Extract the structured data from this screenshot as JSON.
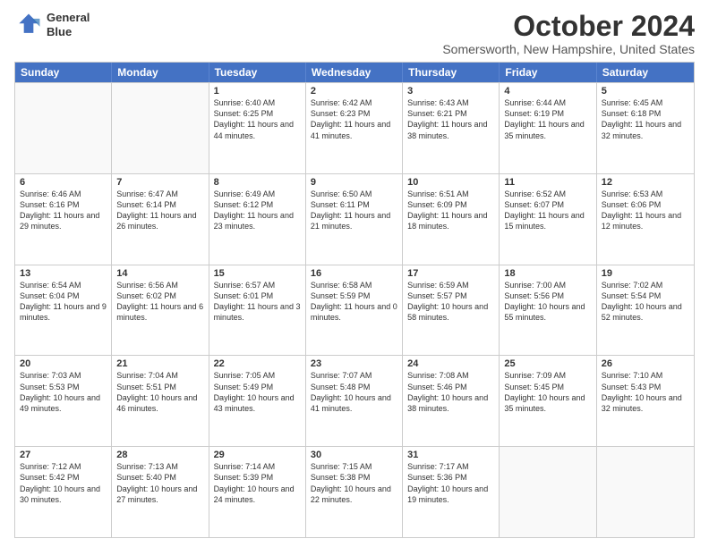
{
  "header": {
    "logo_line1": "General",
    "logo_line2": "Blue",
    "title": "October 2024",
    "subtitle": "Somersworth, New Hampshire, United States"
  },
  "days_of_week": [
    "Sunday",
    "Monday",
    "Tuesday",
    "Wednesday",
    "Thursday",
    "Friday",
    "Saturday"
  ],
  "weeks": [
    [
      {
        "day": "",
        "sunrise": "",
        "sunset": "",
        "daylight": "",
        "empty": true
      },
      {
        "day": "",
        "sunrise": "",
        "sunset": "",
        "daylight": "",
        "empty": true
      },
      {
        "day": "1",
        "sunrise": "Sunrise: 6:40 AM",
        "sunset": "Sunset: 6:25 PM",
        "daylight": "Daylight: 11 hours and 44 minutes."
      },
      {
        "day": "2",
        "sunrise": "Sunrise: 6:42 AM",
        "sunset": "Sunset: 6:23 PM",
        "daylight": "Daylight: 11 hours and 41 minutes."
      },
      {
        "day": "3",
        "sunrise": "Sunrise: 6:43 AM",
        "sunset": "Sunset: 6:21 PM",
        "daylight": "Daylight: 11 hours and 38 minutes."
      },
      {
        "day": "4",
        "sunrise": "Sunrise: 6:44 AM",
        "sunset": "Sunset: 6:19 PM",
        "daylight": "Daylight: 11 hours and 35 minutes."
      },
      {
        "day": "5",
        "sunrise": "Sunrise: 6:45 AM",
        "sunset": "Sunset: 6:18 PM",
        "daylight": "Daylight: 11 hours and 32 minutes."
      }
    ],
    [
      {
        "day": "6",
        "sunrise": "Sunrise: 6:46 AM",
        "sunset": "Sunset: 6:16 PM",
        "daylight": "Daylight: 11 hours and 29 minutes."
      },
      {
        "day": "7",
        "sunrise": "Sunrise: 6:47 AM",
        "sunset": "Sunset: 6:14 PM",
        "daylight": "Daylight: 11 hours and 26 minutes."
      },
      {
        "day": "8",
        "sunrise": "Sunrise: 6:49 AM",
        "sunset": "Sunset: 6:12 PM",
        "daylight": "Daylight: 11 hours and 23 minutes."
      },
      {
        "day": "9",
        "sunrise": "Sunrise: 6:50 AM",
        "sunset": "Sunset: 6:11 PM",
        "daylight": "Daylight: 11 hours and 21 minutes."
      },
      {
        "day": "10",
        "sunrise": "Sunrise: 6:51 AM",
        "sunset": "Sunset: 6:09 PM",
        "daylight": "Daylight: 11 hours and 18 minutes."
      },
      {
        "day": "11",
        "sunrise": "Sunrise: 6:52 AM",
        "sunset": "Sunset: 6:07 PM",
        "daylight": "Daylight: 11 hours and 15 minutes."
      },
      {
        "day": "12",
        "sunrise": "Sunrise: 6:53 AM",
        "sunset": "Sunset: 6:06 PM",
        "daylight": "Daylight: 11 hours and 12 minutes."
      }
    ],
    [
      {
        "day": "13",
        "sunrise": "Sunrise: 6:54 AM",
        "sunset": "Sunset: 6:04 PM",
        "daylight": "Daylight: 11 hours and 9 minutes."
      },
      {
        "day": "14",
        "sunrise": "Sunrise: 6:56 AM",
        "sunset": "Sunset: 6:02 PM",
        "daylight": "Daylight: 11 hours and 6 minutes."
      },
      {
        "day": "15",
        "sunrise": "Sunrise: 6:57 AM",
        "sunset": "Sunset: 6:01 PM",
        "daylight": "Daylight: 11 hours and 3 minutes."
      },
      {
        "day": "16",
        "sunrise": "Sunrise: 6:58 AM",
        "sunset": "Sunset: 5:59 PM",
        "daylight": "Daylight: 11 hours and 0 minutes."
      },
      {
        "day": "17",
        "sunrise": "Sunrise: 6:59 AM",
        "sunset": "Sunset: 5:57 PM",
        "daylight": "Daylight: 10 hours and 58 minutes."
      },
      {
        "day": "18",
        "sunrise": "Sunrise: 7:00 AM",
        "sunset": "Sunset: 5:56 PM",
        "daylight": "Daylight: 10 hours and 55 minutes."
      },
      {
        "day": "19",
        "sunrise": "Sunrise: 7:02 AM",
        "sunset": "Sunset: 5:54 PM",
        "daylight": "Daylight: 10 hours and 52 minutes."
      }
    ],
    [
      {
        "day": "20",
        "sunrise": "Sunrise: 7:03 AM",
        "sunset": "Sunset: 5:53 PM",
        "daylight": "Daylight: 10 hours and 49 minutes."
      },
      {
        "day": "21",
        "sunrise": "Sunrise: 7:04 AM",
        "sunset": "Sunset: 5:51 PM",
        "daylight": "Daylight: 10 hours and 46 minutes."
      },
      {
        "day": "22",
        "sunrise": "Sunrise: 7:05 AM",
        "sunset": "Sunset: 5:49 PM",
        "daylight": "Daylight: 10 hours and 43 minutes."
      },
      {
        "day": "23",
        "sunrise": "Sunrise: 7:07 AM",
        "sunset": "Sunset: 5:48 PM",
        "daylight": "Daylight: 10 hours and 41 minutes."
      },
      {
        "day": "24",
        "sunrise": "Sunrise: 7:08 AM",
        "sunset": "Sunset: 5:46 PM",
        "daylight": "Daylight: 10 hours and 38 minutes."
      },
      {
        "day": "25",
        "sunrise": "Sunrise: 7:09 AM",
        "sunset": "Sunset: 5:45 PM",
        "daylight": "Daylight: 10 hours and 35 minutes."
      },
      {
        "day": "26",
        "sunrise": "Sunrise: 7:10 AM",
        "sunset": "Sunset: 5:43 PM",
        "daylight": "Daylight: 10 hours and 32 minutes."
      }
    ],
    [
      {
        "day": "27",
        "sunrise": "Sunrise: 7:12 AM",
        "sunset": "Sunset: 5:42 PM",
        "daylight": "Daylight: 10 hours and 30 minutes."
      },
      {
        "day": "28",
        "sunrise": "Sunrise: 7:13 AM",
        "sunset": "Sunset: 5:40 PM",
        "daylight": "Daylight: 10 hours and 27 minutes."
      },
      {
        "day": "29",
        "sunrise": "Sunrise: 7:14 AM",
        "sunset": "Sunset: 5:39 PM",
        "daylight": "Daylight: 10 hours and 24 minutes."
      },
      {
        "day": "30",
        "sunrise": "Sunrise: 7:15 AM",
        "sunset": "Sunset: 5:38 PM",
        "daylight": "Daylight: 10 hours and 22 minutes."
      },
      {
        "day": "31",
        "sunrise": "Sunrise: 7:17 AM",
        "sunset": "Sunset: 5:36 PM",
        "daylight": "Daylight: 10 hours and 19 minutes."
      },
      {
        "day": "",
        "sunrise": "",
        "sunset": "",
        "daylight": "",
        "empty": true
      },
      {
        "day": "",
        "sunrise": "",
        "sunset": "",
        "daylight": "",
        "empty": true
      }
    ]
  ]
}
